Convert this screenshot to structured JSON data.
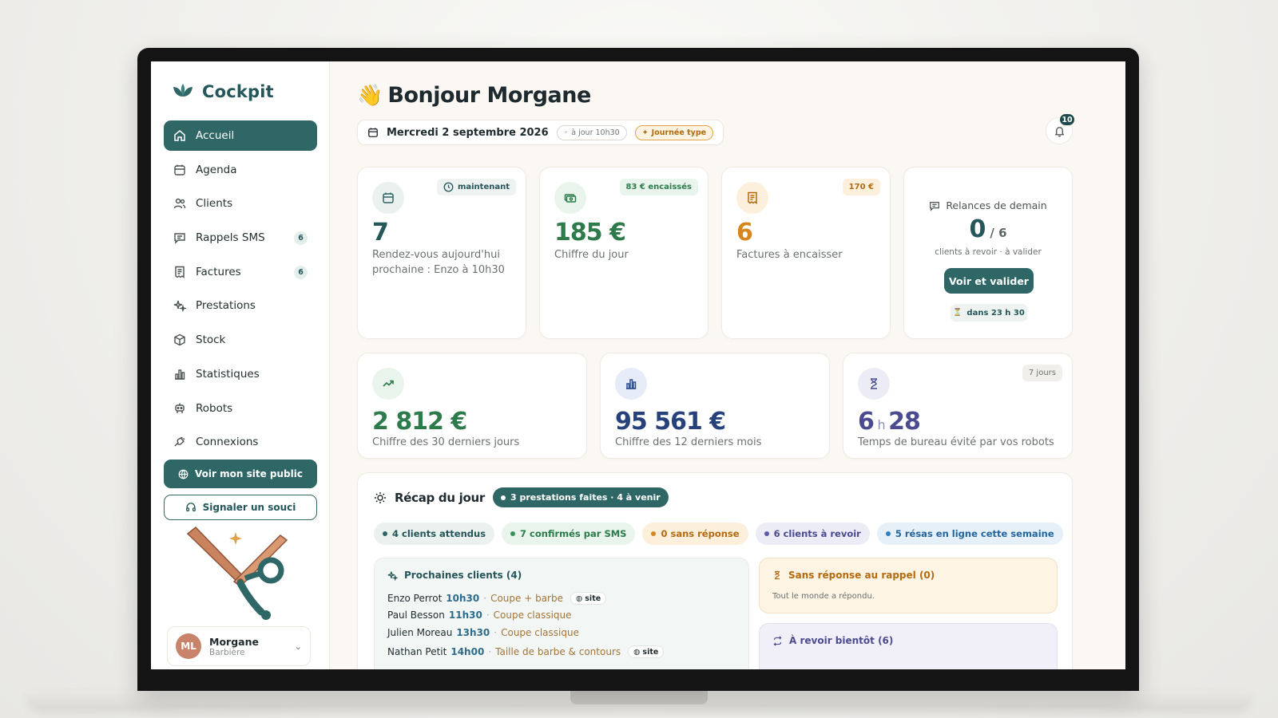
{
  "brand": {
    "name": "Cockpit",
    "accent": "#2f6666"
  },
  "sidebar": {
    "items": [
      {
        "label": "Accueil",
        "icon": "home-icon",
        "active": true
      },
      {
        "label": "Agenda",
        "icon": "calendar-icon"
      },
      {
        "label": "Clients",
        "icon": "users-icon"
      },
      {
        "label": "Rappels SMS",
        "icon": "message-icon",
        "badge": "6"
      },
      {
        "label": "Factures",
        "icon": "receipt-icon",
        "badge": "6"
      },
      {
        "label": "Prestations",
        "icon": "sparkles-icon"
      },
      {
        "label": "Stock",
        "icon": "box-icon"
      },
      {
        "label": "Statistiques",
        "icon": "bar-chart-icon"
      },
      {
        "label": "Robots",
        "icon": "robot-icon"
      },
      {
        "label": "Connexions",
        "icon": "plug-icon"
      }
    ],
    "public_site_label": "Voir mon site public",
    "report_label": "Signaler un souci",
    "user": {
      "initials": "ML",
      "name": "Morgane",
      "role": "Barbière"
    }
  },
  "header": {
    "greeting": "Bonjour Morgane",
    "greeting_emoji": "👋",
    "date": "Mercredi 2 septembre 2026",
    "updated": "à jour 10h30",
    "day_type": "Journée type",
    "notifications": "10"
  },
  "kpis": {
    "appointments": {
      "tag": "maintenant",
      "value": "7",
      "label": "Rendez-vous aujourd'hui",
      "next": "prochaine : Enzo à 10h30"
    },
    "day_revenue": {
      "tag": "83 € encaissés",
      "value": "185 €",
      "label": "Chiffre du jour"
    },
    "invoices": {
      "tag": "170 €",
      "value": "6",
      "label": "Factures à encaisser"
    },
    "reminders": {
      "title": "Relances de demain",
      "done": "0",
      "total": "/ 6",
      "sub": "clients à revoir · à valider",
      "button": "Voir et valider",
      "timer": "dans 23 h 30"
    },
    "revenue_30": {
      "value": "2 812 €",
      "label": "Chiffre des 30 derniers jours"
    },
    "revenue_12m": {
      "value": "95 561 €",
      "label": "Chiffre des 12 derniers mois"
    },
    "robots_time": {
      "tag": "7 jours",
      "hours": "6",
      "h_unit": "h",
      "minutes": "28",
      "label": "Temps de bureau évité par vos robots"
    }
  },
  "recap": {
    "title": "Récap du jour",
    "badge": "3 prestations faites · 4 à venir",
    "pills": [
      {
        "label": "4 clients attendus",
        "color": "#2f6666",
        "bg": "#eaf1ee",
        "fg": "#24565a"
      },
      {
        "label": "7 confirmés par SMS",
        "color": "#3a8f5b",
        "bg": "#e8f4ec",
        "fg": "#2d7a4b"
      },
      {
        "label": "0 sans réponse",
        "color": "#d6861c",
        "bg": "#fcf0dd",
        "fg": "#b36a10"
      },
      {
        "label": "6 clients à revoir",
        "color": "#5b5ba8",
        "bg": "#ececf6",
        "fg": "#4b4b90"
      },
      {
        "label": "5 résas en ligne cette semaine",
        "color": "#2f7dc2",
        "bg": "#e6f0f9",
        "fg": "#23659e"
      }
    ],
    "next_clients": {
      "title": "Prochaines clients (4)",
      "rows": [
        {
          "name": "Enzo Perrot",
          "time": "10h30",
          "service": "Coupe + barbe",
          "site": "site"
        },
        {
          "name": "Paul Besson",
          "time": "11h30",
          "service": "Coupe classique",
          "site": ""
        },
        {
          "name": "Julien Moreau",
          "time": "13h30",
          "service": "Coupe classique",
          "site": ""
        },
        {
          "name": "Nathan Petit",
          "time": "14h00",
          "service": "Taille de barbe & contours",
          "site": "site"
        }
      ]
    },
    "no_answer": {
      "title": "Sans réponse au rappel (0)",
      "text": "Tout le monde a répondu."
    },
    "revisit": {
      "title": "À revoir bientôt (6)"
    }
  }
}
